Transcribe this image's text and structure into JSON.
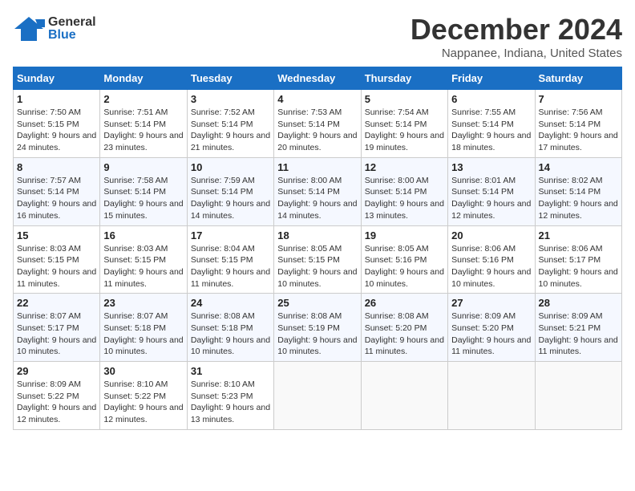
{
  "header": {
    "logo_general": "General",
    "logo_blue": "Blue",
    "month_title": "December 2024",
    "location": "Nappanee, Indiana, United States"
  },
  "weekdays": [
    "Sunday",
    "Monday",
    "Tuesday",
    "Wednesday",
    "Thursday",
    "Friday",
    "Saturday"
  ],
  "weeks": [
    [
      {
        "day": "1",
        "sunrise": "Sunrise: 7:50 AM",
        "sunset": "Sunset: 5:15 PM",
        "daylight": "Daylight: 9 hours and 24 minutes."
      },
      {
        "day": "2",
        "sunrise": "Sunrise: 7:51 AM",
        "sunset": "Sunset: 5:14 PM",
        "daylight": "Daylight: 9 hours and 23 minutes."
      },
      {
        "day": "3",
        "sunrise": "Sunrise: 7:52 AM",
        "sunset": "Sunset: 5:14 PM",
        "daylight": "Daylight: 9 hours and 21 minutes."
      },
      {
        "day": "4",
        "sunrise": "Sunrise: 7:53 AM",
        "sunset": "Sunset: 5:14 PM",
        "daylight": "Daylight: 9 hours and 20 minutes."
      },
      {
        "day": "5",
        "sunrise": "Sunrise: 7:54 AM",
        "sunset": "Sunset: 5:14 PM",
        "daylight": "Daylight: 9 hours and 19 minutes."
      },
      {
        "day": "6",
        "sunrise": "Sunrise: 7:55 AM",
        "sunset": "Sunset: 5:14 PM",
        "daylight": "Daylight: 9 hours and 18 minutes."
      },
      {
        "day": "7",
        "sunrise": "Sunrise: 7:56 AM",
        "sunset": "Sunset: 5:14 PM",
        "daylight": "Daylight: 9 hours and 17 minutes."
      }
    ],
    [
      {
        "day": "8",
        "sunrise": "Sunrise: 7:57 AM",
        "sunset": "Sunset: 5:14 PM",
        "daylight": "Daylight: 9 hours and 16 minutes."
      },
      {
        "day": "9",
        "sunrise": "Sunrise: 7:58 AM",
        "sunset": "Sunset: 5:14 PM",
        "daylight": "Daylight: 9 hours and 15 minutes."
      },
      {
        "day": "10",
        "sunrise": "Sunrise: 7:59 AM",
        "sunset": "Sunset: 5:14 PM",
        "daylight": "Daylight: 9 hours and 14 minutes."
      },
      {
        "day": "11",
        "sunrise": "Sunrise: 8:00 AM",
        "sunset": "Sunset: 5:14 PM",
        "daylight": "Daylight: 9 hours and 14 minutes."
      },
      {
        "day": "12",
        "sunrise": "Sunrise: 8:00 AM",
        "sunset": "Sunset: 5:14 PM",
        "daylight": "Daylight: 9 hours and 13 minutes."
      },
      {
        "day": "13",
        "sunrise": "Sunrise: 8:01 AM",
        "sunset": "Sunset: 5:14 PM",
        "daylight": "Daylight: 9 hours and 12 minutes."
      },
      {
        "day": "14",
        "sunrise": "Sunrise: 8:02 AM",
        "sunset": "Sunset: 5:14 PM",
        "daylight": "Daylight: 9 hours and 12 minutes."
      }
    ],
    [
      {
        "day": "15",
        "sunrise": "Sunrise: 8:03 AM",
        "sunset": "Sunset: 5:15 PM",
        "daylight": "Daylight: 9 hours and 11 minutes."
      },
      {
        "day": "16",
        "sunrise": "Sunrise: 8:03 AM",
        "sunset": "Sunset: 5:15 PM",
        "daylight": "Daylight: 9 hours and 11 minutes."
      },
      {
        "day": "17",
        "sunrise": "Sunrise: 8:04 AM",
        "sunset": "Sunset: 5:15 PM",
        "daylight": "Daylight: 9 hours and 11 minutes."
      },
      {
        "day": "18",
        "sunrise": "Sunrise: 8:05 AM",
        "sunset": "Sunset: 5:15 PM",
        "daylight": "Daylight: 9 hours and 10 minutes."
      },
      {
        "day": "19",
        "sunrise": "Sunrise: 8:05 AM",
        "sunset": "Sunset: 5:16 PM",
        "daylight": "Daylight: 9 hours and 10 minutes."
      },
      {
        "day": "20",
        "sunrise": "Sunrise: 8:06 AM",
        "sunset": "Sunset: 5:16 PM",
        "daylight": "Daylight: 9 hours and 10 minutes."
      },
      {
        "day": "21",
        "sunrise": "Sunrise: 8:06 AM",
        "sunset": "Sunset: 5:17 PM",
        "daylight": "Daylight: 9 hours and 10 minutes."
      }
    ],
    [
      {
        "day": "22",
        "sunrise": "Sunrise: 8:07 AM",
        "sunset": "Sunset: 5:17 PM",
        "daylight": "Daylight: 9 hours and 10 minutes."
      },
      {
        "day": "23",
        "sunrise": "Sunrise: 8:07 AM",
        "sunset": "Sunset: 5:18 PM",
        "daylight": "Daylight: 9 hours and 10 minutes."
      },
      {
        "day": "24",
        "sunrise": "Sunrise: 8:08 AM",
        "sunset": "Sunset: 5:18 PM",
        "daylight": "Daylight: 9 hours and 10 minutes."
      },
      {
        "day": "25",
        "sunrise": "Sunrise: 8:08 AM",
        "sunset": "Sunset: 5:19 PM",
        "daylight": "Daylight: 9 hours and 10 minutes."
      },
      {
        "day": "26",
        "sunrise": "Sunrise: 8:08 AM",
        "sunset": "Sunset: 5:20 PM",
        "daylight": "Daylight: 9 hours and 11 minutes."
      },
      {
        "day": "27",
        "sunrise": "Sunrise: 8:09 AM",
        "sunset": "Sunset: 5:20 PM",
        "daylight": "Daylight: 9 hours and 11 minutes."
      },
      {
        "day": "28",
        "sunrise": "Sunrise: 8:09 AM",
        "sunset": "Sunset: 5:21 PM",
        "daylight": "Daylight: 9 hours and 11 minutes."
      }
    ],
    [
      {
        "day": "29",
        "sunrise": "Sunrise: 8:09 AM",
        "sunset": "Sunset: 5:22 PM",
        "daylight": "Daylight: 9 hours and 12 minutes."
      },
      {
        "day": "30",
        "sunrise": "Sunrise: 8:10 AM",
        "sunset": "Sunset: 5:22 PM",
        "daylight": "Daylight: 9 hours and 12 minutes."
      },
      {
        "day": "31",
        "sunrise": "Sunrise: 8:10 AM",
        "sunset": "Sunset: 5:23 PM",
        "daylight": "Daylight: 9 hours and 13 minutes."
      },
      null,
      null,
      null,
      null
    ]
  ]
}
